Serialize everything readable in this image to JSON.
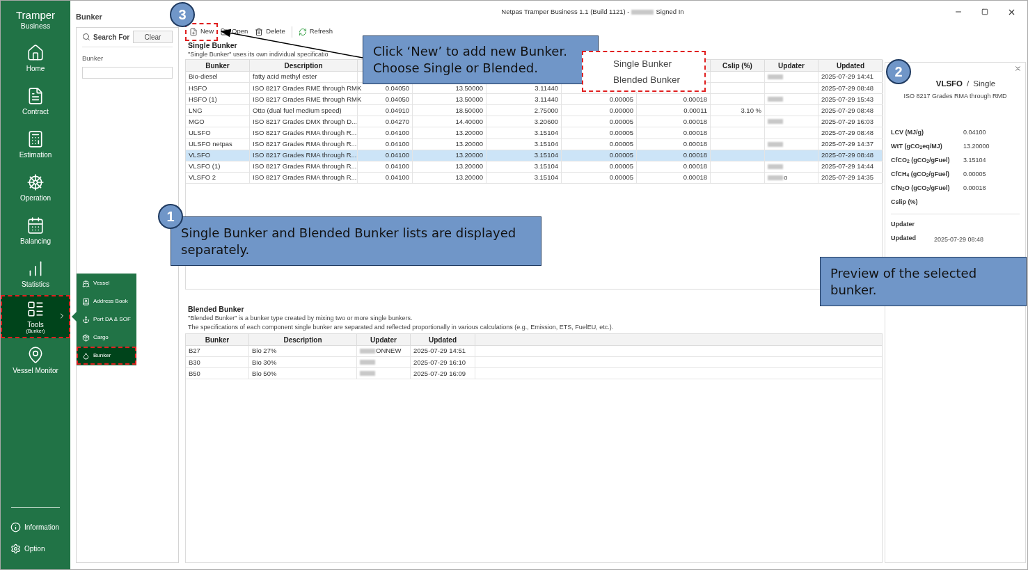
{
  "window": {
    "title": "Netpas Tramper Business 1.1 (Build 1121) -",
    "title_redacted": true,
    "title_suffix": "Signed In"
  },
  "nav": {
    "brand": "Tramper",
    "brand_sub": "Business",
    "items": [
      {
        "label": "Home",
        "selected": false,
        "highlighted": false,
        "expandable": false
      },
      {
        "label": "Contract",
        "selected": false,
        "highlighted": false,
        "expandable": false
      },
      {
        "label": "Estimation",
        "selected": false,
        "highlighted": false,
        "expandable": false
      },
      {
        "label": "Operation",
        "selected": false,
        "highlighted": false,
        "expandable": false
      },
      {
        "label": "Balancing",
        "selected": false,
        "highlighted": false,
        "expandable": false
      },
      {
        "label": "Statistics",
        "selected": false,
        "highlighted": false,
        "expandable": false
      },
      {
        "label": "Tools",
        "sublabel": "(Bunker)",
        "selected": true,
        "highlighted": true,
        "expandable": true
      },
      {
        "label": "Vessel Monitor",
        "selected": false,
        "highlighted": false,
        "expandable": false
      }
    ],
    "footer": [
      {
        "label": "Information"
      },
      {
        "label": "Option"
      }
    ]
  },
  "submenu": {
    "items": [
      {
        "label": "Vessel",
        "selected": false,
        "highlighted": false
      },
      {
        "label": "Address Book",
        "selected": false,
        "highlighted": false
      },
      {
        "label": "Port DA & SOF",
        "selected": false,
        "highlighted": false
      },
      {
        "label": "Cargo",
        "selected": false,
        "highlighted": false
      },
      {
        "label": "Bunker",
        "selected": true,
        "highlighted": true
      }
    ]
  },
  "search_panel": {
    "title": "Bunker",
    "search_label": "Search For",
    "clear": "Clear",
    "field_label": "Bunker"
  },
  "toolbar": [
    {
      "label": "New",
      "highlighted": true
    },
    {
      "label": "Open",
      "highlighted": false
    },
    {
      "label": "Delete",
      "highlighted": false
    },
    {
      "label": "Refresh",
      "highlighted": false
    }
  ],
  "new_menu": {
    "highlighted": true,
    "items": [
      "Single Bunker",
      "Blended Bunker"
    ]
  },
  "single": {
    "title": "Single Bunker",
    "description": "\"Single Bunker\" uses its own individual specificatio",
    "columns": [
      "Bunker",
      "Description",
      null,
      null,
      null,
      null,
      null,
      "Cslip (%)",
      "Updater",
      "Updated"
    ],
    "rows": [
      {
        "selected": false,
        "updater_redacted": true,
        "cells": [
          "Bio-diesel",
          "fatty acid methyl ester",
          null,
          null,
          null,
          null,
          null,
          null,
          null,
          "2025-07-29 14:41"
        ]
      },
      {
        "selected": false,
        "updater_redacted": false,
        "cells": [
          "HSFO",
          "ISO 8217 Grades RME through RMK",
          "0.04050",
          "13.50000",
          "3.11440",
          null,
          null,
          null,
          null,
          "2025-07-29 08:48"
        ]
      },
      {
        "selected": false,
        "updater_redacted": true,
        "cells": [
          "HSFO (1)",
          "ISO 8217 Grades RME through RMK",
          "0.04050",
          "13.50000",
          "3.11440",
          "0.00005",
          "0.00018",
          null,
          null,
          "2025-07-29 15:43"
        ]
      },
      {
        "selected": false,
        "updater_redacted": false,
        "cells": [
          "LNG",
          "Otto (dual fuel medium speed)",
          "0.04910",
          "18.50000",
          "2.75000",
          "0.00000",
          "0.00011",
          "3.10 %",
          null,
          "2025-07-29 08:48"
        ]
      },
      {
        "selected": false,
        "updater_redacted": true,
        "cells": [
          "MGO",
          "ISO 8217 Grades DMX through D...",
          "0.04270",
          "14.40000",
          "3.20600",
          "0.00005",
          "0.00018",
          null,
          null,
          "2025-07-29 16:03"
        ]
      },
      {
        "selected": false,
        "updater_redacted": false,
        "cells": [
          "ULSFO",
          "ISO 8217 Grades RMA through R...",
          "0.04100",
          "13.20000",
          "3.15104",
          "0.00005",
          "0.00018",
          null,
          null,
          "2025-07-29 08:48"
        ]
      },
      {
        "selected": false,
        "updater_redacted": true,
        "cells": [
          "ULSFO netpas",
          "ISO 8217 Grades RMA through R...",
          "0.04100",
          "13.20000",
          "3.15104",
          "0.00005",
          "0.00018",
          null,
          null,
          "2025-07-29 14:37"
        ]
      },
      {
        "selected": true,
        "updater_redacted": false,
        "cells": [
          "VLSFO",
          "ISO 8217 Grades RMA through R...",
          "0.04100",
          "13.20000",
          "3.15104",
          "0.00005",
          "0.00018",
          null,
          null,
          "2025-07-29 08:48"
        ]
      },
      {
        "selected": false,
        "updater_redacted": true,
        "cells": [
          "VLSFO (1)",
          "ISO 8217 Grades RMA through R...",
          "0.04100",
          "13.20000",
          "3.15104",
          "0.00005",
          "0.00018",
          null,
          null,
          "2025-07-29 14:44"
        ]
      },
      {
        "selected": false,
        "updater_redacted": true,
        "cells": [
          "VLSFO 2",
          "ISO 8217 Grades RMA through R...",
          "0.04100",
          "13.20000",
          "3.15104",
          "0.00005",
          "0.00018",
          null,
          "o",
          "2025-07-29 14:35"
        ]
      }
    ]
  },
  "blended": {
    "title": "Blended Bunker",
    "description": [
      "\"Blended Bunker\" is a bunker type created by mixing two or more single bunkers.",
      "The specifications of each component single bunker are separated and reflected proportionally in various calculations (e.g., Emission, ETS, FuelEU, etc.)."
    ],
    "columns": [
      "Bunker",
      "Description",
      "Updater",
      "Updated"
    ],
    "rows": [
      {
        "selected": false,
        "updater_redacted": true,
        "cells": [
          "B27",
          "Bio 27%",
          "ONNEW",
          "2025-07-29 14:51"
        ]
      },
      {
        "selected": false,
        "updater_redacted": true,
        "cells": [
          "B30",
          "Bio 30%",
          null,
          "2025-07-29 16:10"
        ]
      },
      {
        "selected": false,
        "updater_redacted": true,
        "cells": [
          "B50",
          "Bio 50%",
          null,
          "2025-07-29 16:09"
        ]
      }
    ]
  },
  "preview": {
    "name": "VLSFO",
    "separator": "/",
    "type": "Single",
    "description": "ISO 8217 Grades RMA through RMD",
    "properties": [
      {
        "label": "LCV (MJ/g)",
        "value": "0.04100"
      },
      {
        "label": "WtT (gCO$_{2}$eq/MJ)",
        "value": "13.20000"
      },
      {
        "label": "CfCO$_{2}$ (gCO$_{2}$/gFuel)",
        "value": "3.15104"
      },
      {
        "label": "CfCH$_{4}$ (gCO$_{2}$/gFuel)",
        "value": "0.00005"
      },
      {
        "label": "CfN$_{2}$O (gCO$_{2}$/gFuel)",
        "value": "0.00018"
      },
      {
        "label": "Cslip (%)"
      }
    ],
    "meta": [
      {
        "label": "Updater"
      },
      {
        "label": "Updated",
        "value": "2025-07-29 08:48"
      }
    ]
  },
  "annotations": {
    "badges": [
      "3",
      "1",
      "2"
    ],
    "callouts": [
      {
        "lines": [
          "Click ‘New’ to add new Bunker.",
          "Choose Single or Blended."
        ]
      },
      {
        "lines": [
          "Single Bunker and Blended Bunker lists are displayed separately."
        ]
      },
      {
        "lines": [
          "Preview of the selected bunker."
        ]
      }
    ]
  }
}
